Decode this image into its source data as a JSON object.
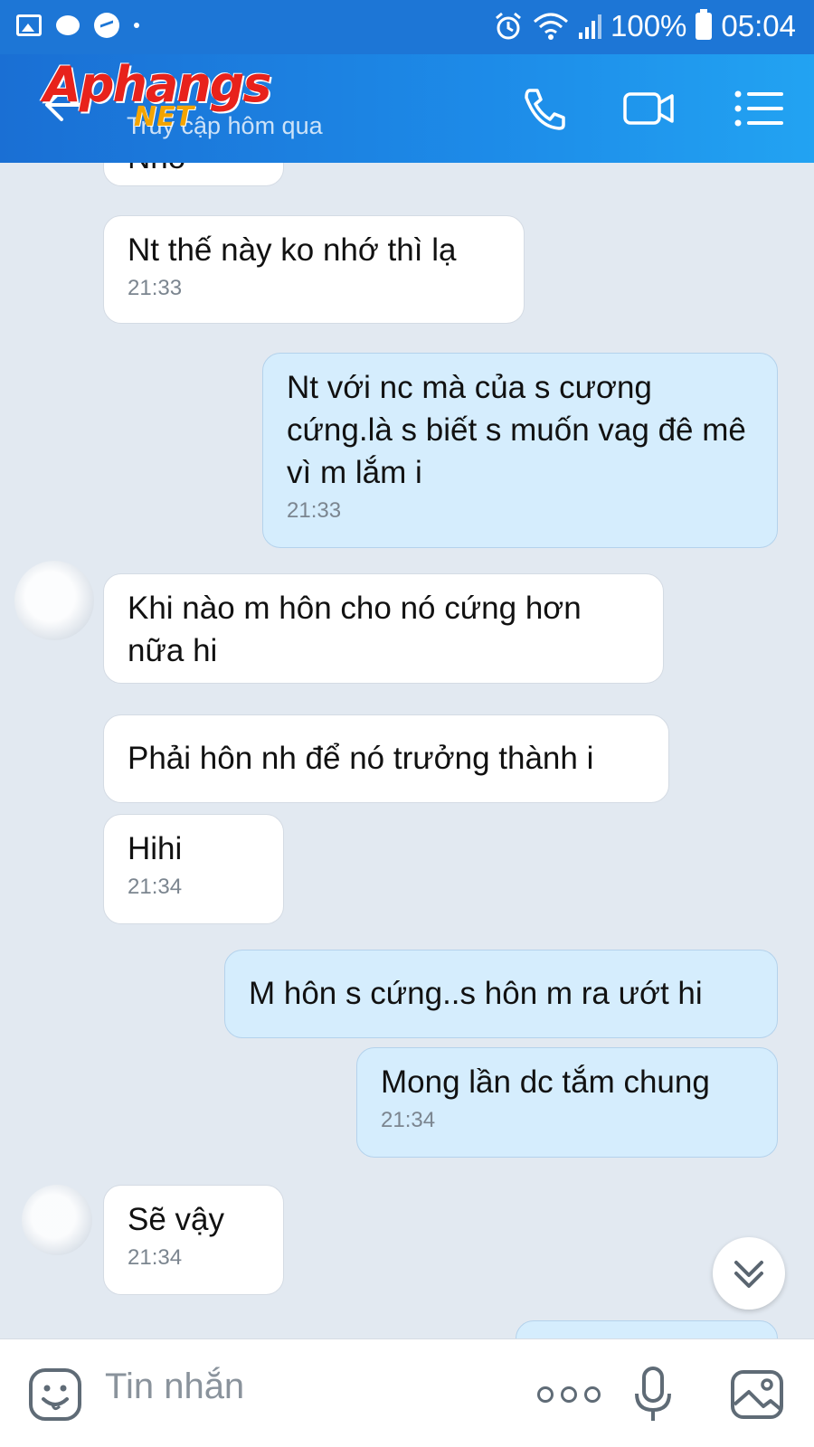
{
  "status_bar": {
    "battery": "100%",
    "time": "05:04",
    "left_icons": [
      "gallery-icon",
      "chat-bubble-icon",
      "messenger-icon",
      "dot-icon"
    ],
    "right_icons": [
      "alarm-icon",
      "wifi-icon",
      "signal-icon",
      "battery-icon"
    ]
  },
  "header": {
    "logo_main": "Aphangs",
    "logo_sub": "NET",
    "status": "Truy cập hôm qua",
    "icons": [
      "back-icon",
      "phone-icon",
      "video-call-icon",
      "menu-icon"
    ],
    "accent": "#1d76d6"
  },
  "chat": {
    "messages": [
      {
        "side": "in",
        "text": "Nhớ",
        "time": ""
      },
      {
        "side": "in",
        "text": "Nt thế này ko nhớ thì lạ",
        "time": "21:33"
      },
      {
        "side": "out",
        "text": "Nt với nc mà của s cương cứng.là s biết s muốn vag đê mê vì m lắm i",
        "time": "21:33"
      },
      {
        "side": "in",
        "text": "Khi nào m hôn cho nó cứng hơn nữa hi",
        "time": ""
      },
      {
        "side": "in",
        "text": "Phải hôn nh để nó trưởng thành i",
        "time": ""
      },
      {
        "side": "in",
        "text": "Hihi",
        "time": "21:34"
      },
      {
        "side": "out",
        "text": "M hôn s cứng..s hôn m ra ướt hi",
        "time": ""
      },
      {
        "side": "out",
        "text": "Mong lần dc tắm chung",
        "time": "21:34"
      },
      {
        "side": "in",
        "text": "Sẽ vậy",
        "time": "21:34"
      }
    ]
  },
  "input": {
    "placeholder": "Tin nhắn",
    "icons": [
      "sticker-icon",
      "more-icon",
      "microphone-icon",
      "image-icon"
    ]
  },
  "colors": {
    "incoming_bubble": "#ffffff",
    "outgoing_bubble": "#d5edfd",
    "chat_background": "#e2e9f1"
  }
}
